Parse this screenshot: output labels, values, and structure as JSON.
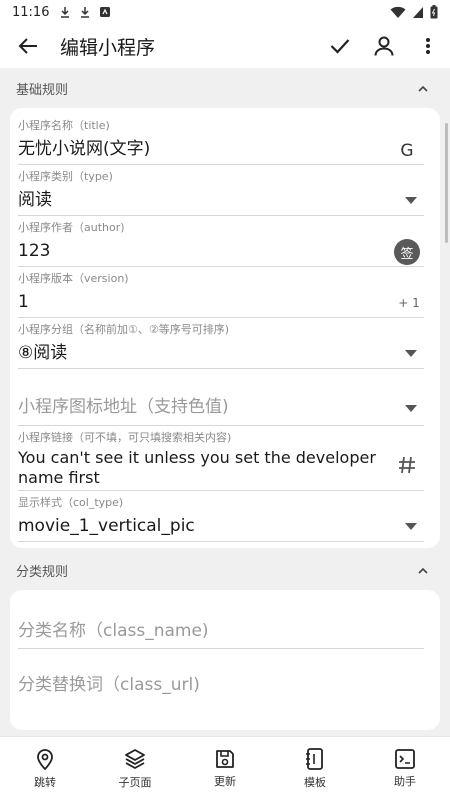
{
  "status_bar": {
    "time": "11:16"
  },
  "app_bar": {
    "title": "编辑小程序"
  },
  "sections": {
    "basic": {
      "title": "基础规则"
    },
    "class": {
      "title": "分类规则"
    }
  },
  "basic_fields": {
    "name": {
      "label": "小程序名称（title)",
      "value": "无忧小说网(文字)",
      "trail_text": "G"
    },
    "type": {
      "label": "小程序类别（type)",
      "value": "阅读"
    },
    "author": {
      "label": "小程序作者（author)",
      "value": "123",
      "trail_text": "签"
    },
    "version": {
      "label": "小程序版本（version)",
      "value": "1",
      "trail_text": "+ 1"
    },
    "group": {
      "label": "小程序分组（名称前加①、②等序号可排序)",
      "value": "⑧阅读"
    },
    "icon": {
      "placeholder": "小程序图标地址（支持色值)"
    },
    "link": {
      "label": "小程序链接（可不填，可只填搜索相关内容)",
      "value_line1": "You can't see it unless you set the developer",
      "value_line2": "name first"
    },
    "col_type": {
      "label": "显示样式（col_type)",
      "value": "movie_1_vertical_pic"
    }
  },
  "class_fields": {
    "class_name": {
      "placeholder": "分类名称（class_name)"
    },
    "class_url": {
      "placeholder": "分类替换词（class_url)"
    }
  },
  "bottom_nav": [
    {
      "label": "跳转",
      "icon": "location-pin-icon"
    },
    {
      "label": "子页面",
      "icon": "layers-icon"
    },
    {
      "label": "更新",
      "icon": "save-icon"
    },
    {
      "label": "模板",
      "icon": "template-icon"
    },
    {
      "label": "助手",
      "icon": "terminal-icon"
    }
  ]
}
